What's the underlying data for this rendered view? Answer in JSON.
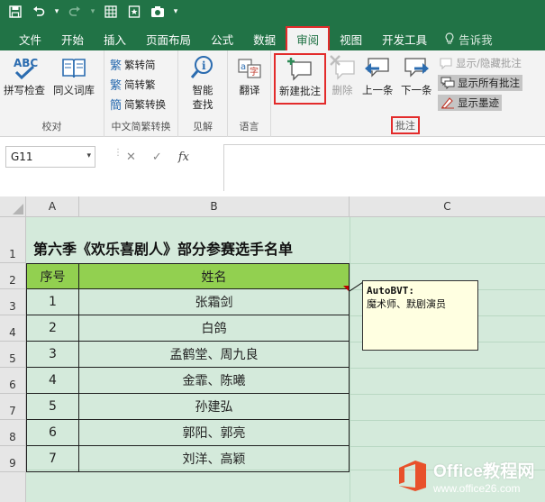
{
  "ribbon_tabs": [
    {
      "label": "文件"
    },
    {
      "label": "开始"
    },
    {
      "label": "插入"
    },
    {
      "label": "页面布局"
    },
    {
      "label": "公式"
    },
    {
      "label": "数据"
    },
    {
      "label": "审阅"
    },
    {
      "label": "视图"
    },
    {
      "label": "开发工具"
    }
  ],
  "tell_me": "告诉我",
  "groups": {
    "proofing": {
      "label": "校对",
      "spell": "拼写检查",
      "thesaurus": "同义词库"
    },
    "chinese": {
      "label": "中文简繁转换",
      "to_simplified": "繁转简",
      "to_traditional": "简转繁",
      "convert": "简繁转换"
    },
    "insights": {
      "label": "见解",
      "smart_lookup_1": "智能",
      "smart_lookup_2": "查找"
    },
    "language": {
      "label": "语言",
      "translate": "翻译"
    },
    "comments": {
      "label": "批注",
      "new": "新建批注",
      "delete": "删除",
      "previous": "上一条",
      "next": "下一条",
      "show_hide": "显示/隐藏批注",
      "show_all": "显示所有批注",
      "show_ink": "显示墨迹"
    }
  },
  "formula_bar": {
    "name_box": "G11",
    "cancel": "✕",
    "enter": "✓",
    "fx": "fx",
    "value": ""
  },
  "columns": [
    "A",
    "B",
    "C"
  ],
  "rows": [
    "1",
    "2",
    "3",
    "4",
    "5",
    "6",
    "7",
    "8",
    "9"
  ],
  "sheet": {
    "title": "第六季《欢乐喜剧人》部分参赛选手名单",
    "headers": [
      "序号",
      "姓名"
    ],
    "data": [
      [
        "1",
        "张霜剑"
      ],
      [
        "2",
        "白鸽"
      ],
      [
        "3",
        "孟鹤堂、周九良"
      ],
      [
        "4",
        "金霏、陈曦"
      ],
      [
        "5",
        "孙建弘"
      ],
      [
        "6",
        "郭阳、郭亮"
      ],
      [
        "7",
        "刘洋、高颖"
      ]
    ]
  },
  "comment": {
    "author": "AutoBVT:",
    "text": "魔术师、默剧演员"
  },
  "watermark": {
    "line1": "Office教程网",
    "line2": "www.office26.com"
  },
  "colors": {
    "excel_green": "#217346",
    "highlight_red": "#e32b2b",
    "header_fill": "#92d050",
    "sheet_fill": "#d4eadb"
  }
}
